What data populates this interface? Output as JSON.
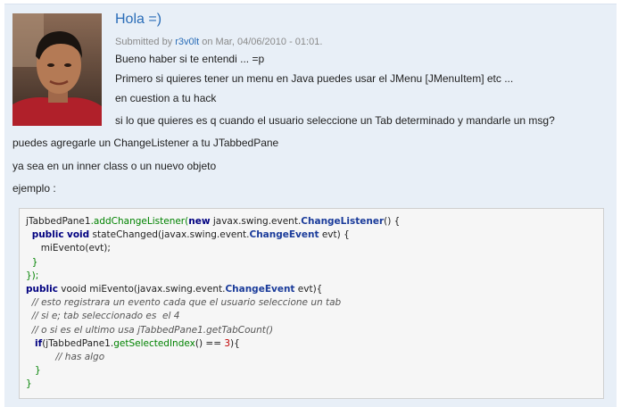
{
  "comment": {
    "title": "Hola =)",
    "submitted_prefix": "Submitted by",
    "author": "r3v0lt",
    "submitted_suffix": "on Mar, 04/06/2010 - 01:01.",
    "paragraphs": [
      "Bueno haber si te entendi ... =p",
      "Primero si quieres tener un menu en Java puedes usar el JMenu [JMenuItem] etc ...",
      "en cuestion a tu hack",
      "si lo que quieres es q cuando el usuario seleccione un Tab determinado y mandarle un msg?",
      "puedes agregarle un ChangeListener a tu JTabbedPane",
      "ya sea en un inner class o un nuevo objeto",
      "ejemplo :"
    ]
  },
  "code": {
    "l1": {
      "a": "jTabbedPane1",
      "b": ".addChangeListener(",
      "c": "new",
      "d": " javax.swing.event.",
      "e": "ChangeListener",
      "f": "() {"
    },
    "l2": {
      "a": "public",
      "b": "void",
      "c": " stateChanged(javax.swing.event.",
      "d": "ChangeEvent",
      "e": " evt) {"
    },
    "l3": {
      "a": "miEvento(evt);"
    },
    "l4": {
      "a": "}"
    },
    "l5": {
      "a": "});"
    },
    "l6": {
      "a": "public",
      "b": " vooid miEvento(javax.swing.event.",
      "c": "ChangeEvent",
      "d": " evt){"
    },
    "l7": "// esto registrara un evento cada que el usuario seleccione un tab",
    "l8": "// si e; tab seleccionado es  el 4",
    "l9": "// o si es el ultimo usa jTabbedPane1.getTabCount()",
    "l10": {
      "a": "if",
      "b": "(jTabbedPane1.",
      "c": "getSelectedIndex",
      "d": "() == ",
      "e": "3",
      "f": "){"
    },
    "l11": "// has algo",
    "l12": "}",
    "l13": "}"
  }
}
